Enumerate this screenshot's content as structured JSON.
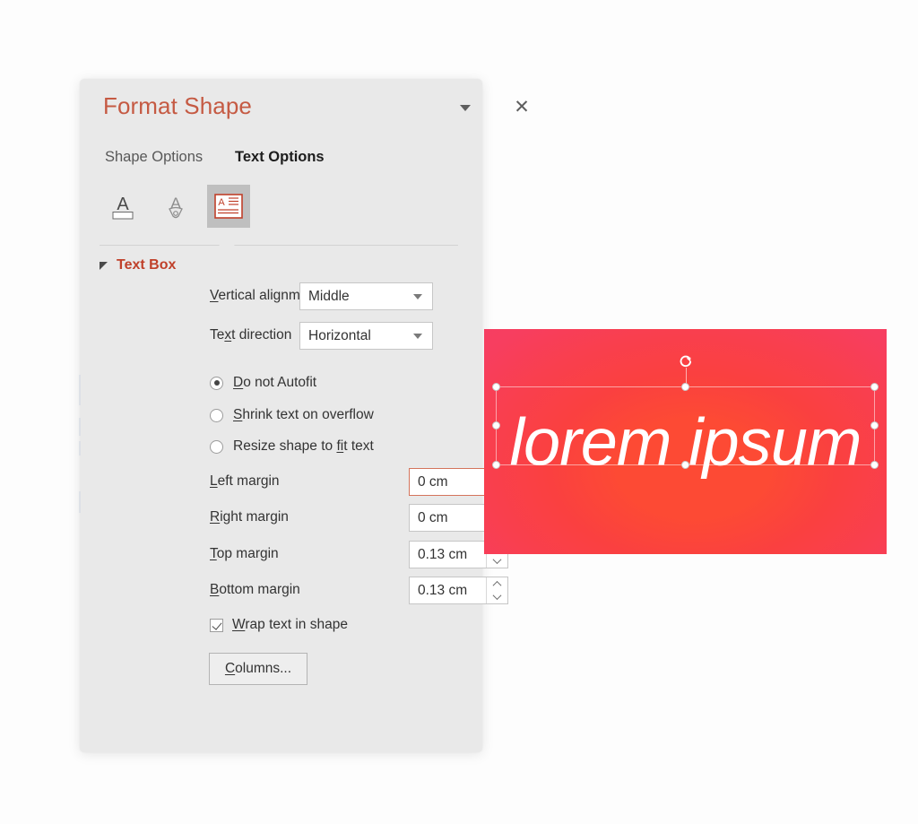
{
  "pane": {
    "title": "Format Shape",
    "menu_icon": "chevron-down-icon",
    "close_icon": "close-icon",
    "tabs": [
      {
        "label": "Shape Options",
        "active": false
      },
      {
        "label": "Text Options",
        "active": true
      }
    ],
    "icon_strip": [
      {
        "name": "text-fill-icon",
        "selected": false
      },
      {
        "name": "text-effects-icon",
        "selected": false
      },
      {
        "name": "textbox-layout-icon",
        "selected": true
      }
    ],
    "section": {
      "title": "Text Box",
      "expanded": true,
      "vertical_alignment": {
        "label_pre": "",
        "label_accel": "V",
        "label_post": "ertical alignment",
        "value": "Middle"
      },
      "text_direction": {
        "label_pre": "Te",
        "label_accel": "x",
        "label_post": "t direction",
        "value": "Horizontal"
      },
      "autofit": {
        "selected": "Do not Autofit",
        "options": [
          {
            "pre": "",
            "accel": "D",
            "post": "o not Autofit",
            "checked": true
          },
          {
            "pre": "",
            "accel": "S",
            "post": "hrink text on overflow",
            "checked": false
          },
          {
            "pre": "Resize shape to ",
            "accel": "fi",
            "post": "t text",
            "checked": false
          }
        ]
      },
      "margins": [
        {
          "pre": "",
          "accel": "L",
          "post": "eft margin",
          "value": "0 cm",
          "focused": true
        },
        {
          "pre": "",
          "accel": "R",
          "post": "ight margin",
          "value": "0 cm",
          "focused": false
        },
        {
          "pre": "",
          "accel": "T",
          "post": "op margin",
          "value": "0.13 cm",
          "focused": false
        },
        {
          "pre": "",
          "accel": "B",
          "post": "ottom margin",
          "value": "0.13 cm",
          "focused": false
        }
      ],
      "wrap_text": {
        "pre": "",
        "accel": "W",
        "post": "rap text in shape",
        "checked": true
      },
      "columns_button": {
        "pre": "",
        "accel": "C",
        "post": "olumns..."
      }
    },
    "colors": {
      "title": "#c55a43",
      "section_title": "#c0402a",
      "pane_bg": "#e9e9e9",
      "focus_border": "#d4745c"
    }
  },
  "slide": {
    "shape_text": "lorem ipsum",
    "selected": true,
    "rotation_icon": "rotate-handle-icon",
    "colors": {
      "gradient_center": "#fd4a34",
      "gradient_edge": "#f73e5f",
      "text": "#ffffff"
    }
  }
}
